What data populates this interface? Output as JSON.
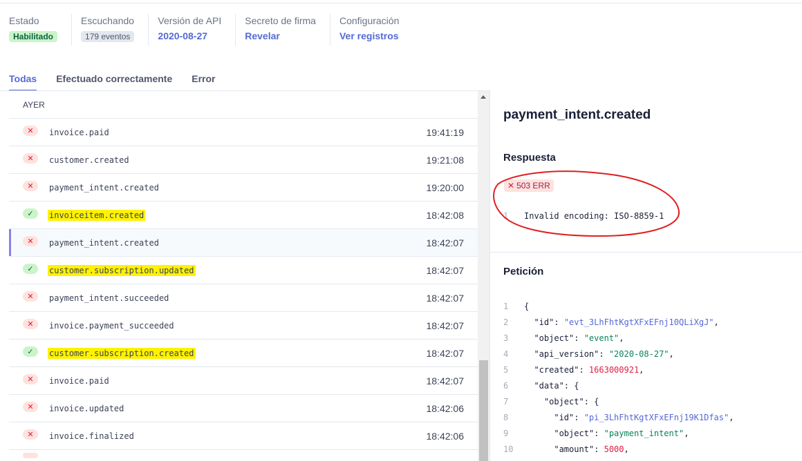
{
  "stats": [
    {
      "label": "Estado",
      "value": "Habilitado",
      "kind": "green"
    },
    {
      "label": "Escuchando",
      "value": "179 eventos",
      "kind": "grey"
    },
    {
      "label": "Versión de API",
      "value": "2020-08-27",
      "kind": "link"
    },
    {
      "label": "Secreto de firma",
      "value": "Revelar",
      "kind": "link"
    },
    {
      "label": "Configuración",
      "value": "Ver registros",
      "kind": "link"
    }
  ],
  "tabs": [
    "Todas",
    "Efectuado correctamente",
    "Error"
  ],
  "list": {
    "group": "AYER",
    "rows": [
      {
        "name": "invoice.paid",
        "time": "19:41:19",
        "status": "fail",
        "highlight": false
      },
      {
        "name": "customer.created",
        "time": "19:21:08",
        "status": "fail",
        "highlight": false
      },
      {
        "name": "payment_intent.created",
        "time": "19:20:00",
        "status": "fail",
        "highlight": false
      },
      {
        "name": "invoiceitem.created",
        "time": "18:42:08",
        "status": "ok",
        "highlight": true
      },
      {
        "name": "payment_intent.created",
        "time": "18:42:07",
        "status": "fail",
        "highlight": false,
        "selected": true
      },
      {
        "name": "customer.subscription.updated",
        "time": "18:42:07",
        "status": "ok",
        "highlight": true
      },
      {
        "name": "payment_intent.succeeded",
        "time": "18:42:07",
        "status": "fail",
        "highlight": false
      },
      {
        "name": "invoice.payment_succeeded",
        "time": "18:42:07",
        "status": "fail",
        "highlight": false
      },
      {
        "name": "customer.subscription.created",
        "time": "18:42:07",
        "status": "ok",
        "highlight": true
      },
      {
        "name": "invoice.paid",
        "time": "18:42:07",
        "status": "fail",
        "highlight": false
      },
      {
        "name": "invoice.updated",
        "time": "18:42:06",
        "status": "fail",
        "highlight": false
      },
      {
        "name": "invoice.finalized",
        "time": "18:42:06",
        "status": "fail",
        "highlight": false
      }
    ]
  },
  "detail": {
    "title": "payment_intent.created",
    "response_title": "Respuesta",
    "response_badge": "503 ERR",
    "response_line_no": "1",
    "response_text": "Invalid encoding: ISO-8859-1",
    "request_title": "Petición",
    "code": [
      {
        "ln": "1",
        "parts": [
          [
            "k",
            "{"
          ]
        ]
      },
      {
        "ln": "2",
        "parts": [
          [
            "k",
            "  \"id\": "
          ],
          [
            "id",
            "\"evt_3LhFhtKgtXFxEFnj10QLiXgJ\""
          ],
          [
            "k",
            ","
          ]
        ]
      },
      {
        "ln": "3",
        "parts": [
          [
            "k",
            "  \"object\": "
          ],
          [
            "s",
            "\"event\""
          ],
          [
            "k",
            ","
          ]
        ]
      },
      {
        "ln": "4",
        "parts": [
          [
            "k",
            "  \"api_version\": "
          ],
          [
            "s",
            "\"2020-08-27\""
          ],
          [
            "k",
            ","
          ]
        ]
      },
      {
        "ln": "5",
        "parts": [
          [
            "k",
            "  \"created\": "
          ],
          [
            "n",
            "1663000921"
          ],
          [
            "k",
            ","
          ]
        ]
      },
      {
        "ln": "6",
        "parts": [
          [
            "k",
            "  \"data\": {"
          ]
        ]
      },
      {
        "ln": "7",
        "parts": [
          [
            "k",
            "    \"object\": {"
          ]
        ]
      },
      {
        "ln": "8",
        "parts": [
          [
            "k",
            "      \"id\": "
          ],
          [
            "id",
            "\"pi_3LhFhtKgtXFxEFnj19K1Dfas\""
          ],
          [
            "k",
            ","
          ]
        ]
      },
      {
        "ln": "9",
        "parts": [
          [
            "k",
            "      \"object\": "
          ],
          [
            "s",
            "\"payment_intent\""
          ],
          [
            "k",
            ","
          ]
        ]
      },
      {
        "ln": "10",
        "parts": [
          [
            "k",
            "      \"amount\": "
          ],
          [
            "n",
            "5000"
          ],
          [
            "k",
            ","
          ]
        ]
      }
    ]
  }
}
